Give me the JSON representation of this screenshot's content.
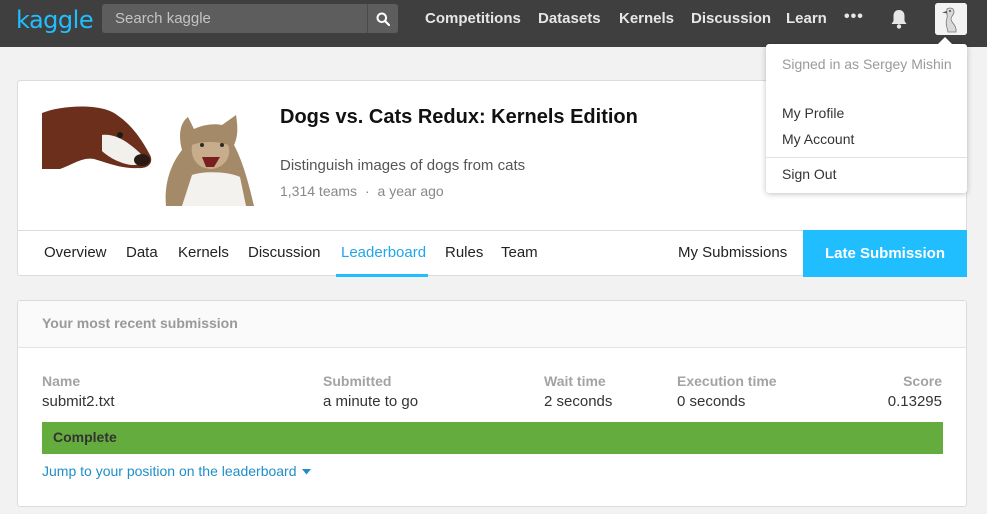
{
  "header": {
    "logo": "kaggle",
    "search_placeholder": "Search kaggle",
    "nav": [
      "Competitions",
      "Datasets",
      "Kernels",
      "Discussion",
      "Learn"
    ],
    "more": "•••",
    "accent": "#20beff"
  },
  "account_menu": {
    "signed_in": "Signed in as Sergey Mishin",
    "items": [
      "My Profile",
      "My Account",
      "Sign Out"
    ]
  },
  "competition": {
    "title": "Dogs vs. Cats Redux: Kernels Edition",
    "subtitle": "Distinguish images of dogs from cats",
    "teams": "1,314 teams",
    "separator": "·",
    "age": "a year ago",
    "tabs": [
      "Overview",
      "Data",
      "Kernels",
      "Discussion",
      "Leaderboard",
      "Rules",
      "Team"
    ],
    "active_tab": "Leaderboard",
    "my_submissions": "My Submissions",
    "late_submission": "Late Submission"
  },
  "submission": {
    "heading": "Your most recent submission",
    "columns": {
      "name": {
        "label": "Name",
        "value": "submit2.txt"
      },
      "submitted": {
        "label": "Submitted",
        "value": "a minute to go"
      },
      "wait": {
        "label": "Wait time",
        "value": "2 seconds"
      },
      "execution": {
        "label": "Execution time",
        "value": "0 seconds"
      },
      "score": {
        "label": "Score",
        "value": "0.13295"
      }
    },
    "status": "Complete",
    "status_color": "#64ac3e",
    "jump_link": "Jump to your position on the leaderboard"
  }
}
